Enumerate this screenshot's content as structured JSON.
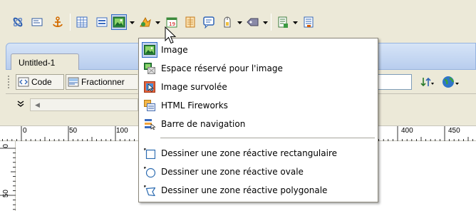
{
  "toolbar": {
    "tools": [
      {
        "icon": "hyperlink-icon"
      },
      {
        "icon": "email-link-icon"
      },
      {
        "icon": "named-anchor-icon"
      },
      {
        "icon": "table-icon"
      },
      {
        "icon": "layer-icon"
      },
      {
        "icon": "image-icon",
        "has_menu": true,
        "active": true
      },
      {
        "icon": "media-icon",
        "has_menu": true
      },
      {
        "icon": "date-icon"
      },
      {
        "icon": "comment-icon"
      },
      {
        "icon": "templates-icon"
      },
      {
        "icon": "head-tags-icon",
        "has_menu": true
      },
      {
        "icon": "tag-chooser-icon",
        "has_menu": true
      },
      {
        "icon": "script-icon",
        "has_menu": true
      },
      {
        "icon": "server-include-icon"
      }
    ]
  },
  "document": {
    "tab_label": "Untitled-1",
    "views": {
      "code_label": "Code",
      "split_label": "Fractionner"
    }
  },
  "ruler": {
    "ticks": [
      "0",
      "50",
      "100",
      "400",
      "450"
    ],
    "vticks": [
      "0",
      "50"
    ]
  },
  "menu": {
    "items": [
      {
        "label": "Image",
        "icon": "image-icon",
        "highlighted": true
      },
      {
        "label": "Espace réservé pour l'image",
        "icon": "image-placeholder-icon"
      },
      {
        "label": "Image survolée",
        "icon": "rollover-image-icon"
      },
      {
        "label": "HTML Fireworks",
        "icon": "fireworks-html-icon"
      },
      {
        "label": "Barre de navigation",
        "icon": "navigation-bar-icon"
      }
    ],
    "hotspot_items": [
      {
        "label": "Dessiner une zone réactive rectangulaire",
        "icon": "rectangle-hotspot-icon"
      },
      {
        "label": "Dessiner une zone réactive ovale",
        "icon": "oval-hotspot-icon"
      },
      {
        "label": "Dessiner une zone réactive polygonale",
        "icon": "polygon-hotspot-icon"
      }
    ]
  },
  "colors": {
    "chrome": "#ece9d8",
    "menu_highlight": "#c1d2ee",
    "highlight_border": "#316ac5"
  }
}
